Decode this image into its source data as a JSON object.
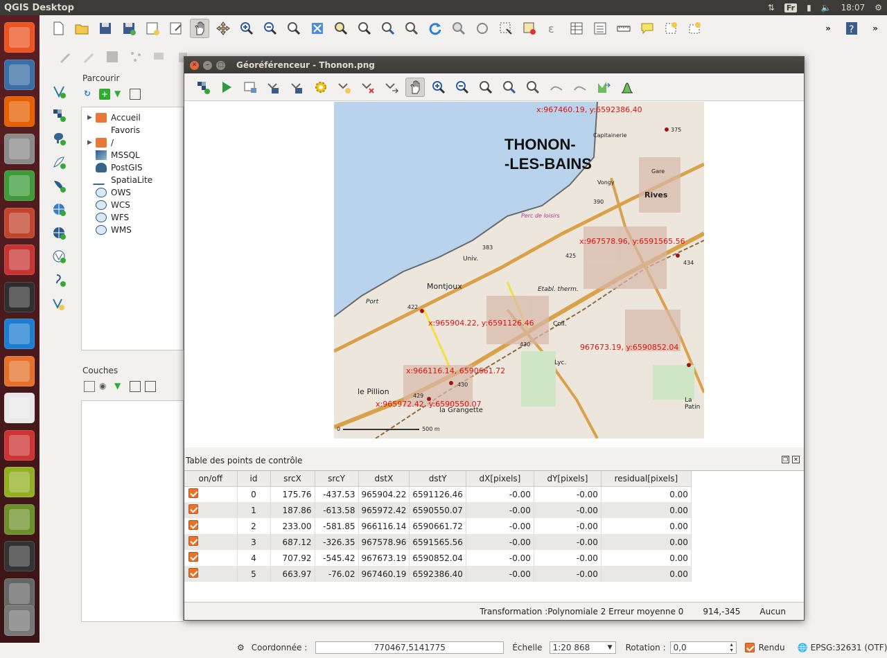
{
  "topbar": {
    "title": "QGIS Desktop",
    "keyboard": "Fr",
    "time": "18:07"
  },
  "launcher": {
    "items": [
      {
        "name": "ubuntu-dash",
        "color": "#e95420"
      },
      {
        "name": "image-viewer",
        "color": "#3a6ea5"
      },
      {
        "name": "firefox",
        "color": "#e66000"
      },
      {
        "name": "file-manager",
        "color": "#8a8a8a"
      },
      {
        "name": "libreoffice-calc",
        "color": "#3f9b3a"
      },
      {
        "name": "libreoffice-impress",
        "color": "#c0452c"
      },
      {
        "name": "libreoffice-draw",
        "color": "#c73434"
      },
      {
        "name": "terminal",
        "color": "#2e2e2e"
      },
      {
        "name": "kde-connect",
        "color": "#1d7ecf"
      },
      {
        "name": "software-center",
        "color": "#e4702a"
      },
      {
        "name": "amazon",
        "color": "#e8e8e8"
      },
      {
        "name": "system-settings",
        "color": "#c33"
      },
      {
        "name": "qgis",
        "color": "#93b023"
      },
      {
        "name": "qgis-browser",
        "color": "#6d8f2a"
      },
      {
        "name": "save-disk",
        "color": "#333"
      },
      {
        "name": "media-player",
        "color": "#666"
      },
      {
        "name": "trash",
        "color": "#777"
      }
    ]
  },
  "browser": {
    "title": "Parcourir",
    "items": [
      {
        "label": "Accueil",
        "icon": "folder",
        "arrow": "▶"
      },
      {
        "label": "Favoris",
        "icon": "star",
        "arrow": ""
      },
      {
        "label": "/",
        "icon": "folder",
        "arrow": "▶"
      },
      {
        "label": "MSSQL",
        "icon": "mssql",
        "arrow": ""
      },
      {
        "label": "PostGIS",
        "icon": "postgis",
        "arrow": ""
      },
      {
        "label": "SpatiaLite",
        "icon": "spatialite",
        "arrow": ""
      },
      {
        "label": "OWS",
        "icon": "globe",
        "arrow": ""
      },
      {
        "label": "WCS",
        "icon": "globe",
        "arrow": ""
      },
      {
        "label": "WFS",
        "icon": "globe",
        "arrow": ""
      },
      {
        "label": "WMS",
        "icon": "globe",
        "arrow": ""
      }
    ]
  },
  "layers": {
    "title": "Couches"
  },
  "georef": {
    "title": "Géoréférenceur - Thonon.png",
    "map": {
      "city_line1": "THONON-",
      "city_line2": "-LES-BAINS",
      "places": [
        "Montjoux",
        "Rives",
        "le Pillion",
        "la Grangette",
        "Port",
        "Univ.",
        "Lyc.",
        "Coll.",
        "Etabl. therm.",
        "Capitainerie",
        "Gare",
        "Vongy",
        "Perc de loisirs",
        "La Patin"
      ],
      "elevations": [
        "375",
        "390",
        "383",
        "425",
        "422",
        "430",
        "434",
        "429",
        "430"
      ],
      "scale_start": "0",
      "scale_end": "500 m",
      "gcp_labels": [
        "x:967460.19, y:6592386.40",
        "x:967578.96, y:6591565.56",
        "x:965904.22, y:6591126.46",
        "967673.19, y:6590852.04",
        "x:966116.14, 6590661.72",
        "x:965972.42, y:6590550.07"
      ]
    },
    "gcp_table": {
      "title": "Table des points de contrôle",
      "headers": [
        "on/off",
        "id",
        "srcX",
        "srcY",
        "dstX",
        "dstY",
        "dX[pixels]",
        "dY[pixels]",
        "residual[pixels]"
      ],
      "rows": [
        {
          "on": true,
          "id": "0",
          "srcX": "175.76",
          "srcY": "-437.53",
          "dstX": "965904.22",
          "dstY": "6591126.46",
          "dX": "-0.00",
          "dY": "-0.00",
          "res": "0.00"
        },
        {
          "on": true,
          "id": "1",
          "srcX": "187.86",
          "srcY": "-613.58",
          "dstX": "965972.42",
          "dstY": "6590550.07",
          "dX": "-0.00",
          "dY": "-0.00",
          "res": "0.00"
        },
        {
          "on": true,
          "id": "2",
          "srcX": "233.00",
          "srcY": "-581.85",
          "dstX": "966116.14",
          "dstY": "6590661.72",
          "dX": "-0.00",
          "dY": "-0.00",
          "res": "0.00"
        },
        {
          "on": true,
          "id": "3",
          "srcX": "687.12",
          "srcY": "-326.35",
          "dstX": "967578.96",
          "dstY": "6591565.56",
          "dX": "-0.00",
          "dY": "-0.00",
          "res": "0.00"
        },
        {
          "on": true,
          "id": "4",
          "srcX": "707.92",
          "srcY": "-545.42",
          "dstX": "967673.19",
          "dstY": "6590852.04",
          "dX": "-0.00",
          "dY": "-0.00",
          "res": "0.00"
        },
        {
          "on": true,
          "id": "5",
          "srcX": "663.97",
          "srcY": "-76.02",
          "dstX": "967460.19",
          "dstY": "6592386.40",
          "dX": "-0.00",
          "dY": "-0.00",
          "res": "0.00"
        }
      ]
    },
    "status": {
      "transformation": "Transformation :Polynomiale 2 Erreur moyenne 0",
      "coords": "914,-345",
      "crs": "Aucun"
    }
  },
  "statusbar": {
    "coord_label": "Coordonnée :",
    "coord_value": "770467,5141775",
    "scale_label": "Échelle",
    "scale_value": "1:20 868",
    "rotation_label": "Rotation :",
    "rotation_value": "0,0",
    "render_label": "Rendu",
    "epsg": "EPSG:32631 (OTF)"
  },
  "colors": {
    "accent": "#e8742b",
    "water": "#b9d3ec",
    "road": "#d9a24a",
    "gcp_text": "#e01010"
  }
}
